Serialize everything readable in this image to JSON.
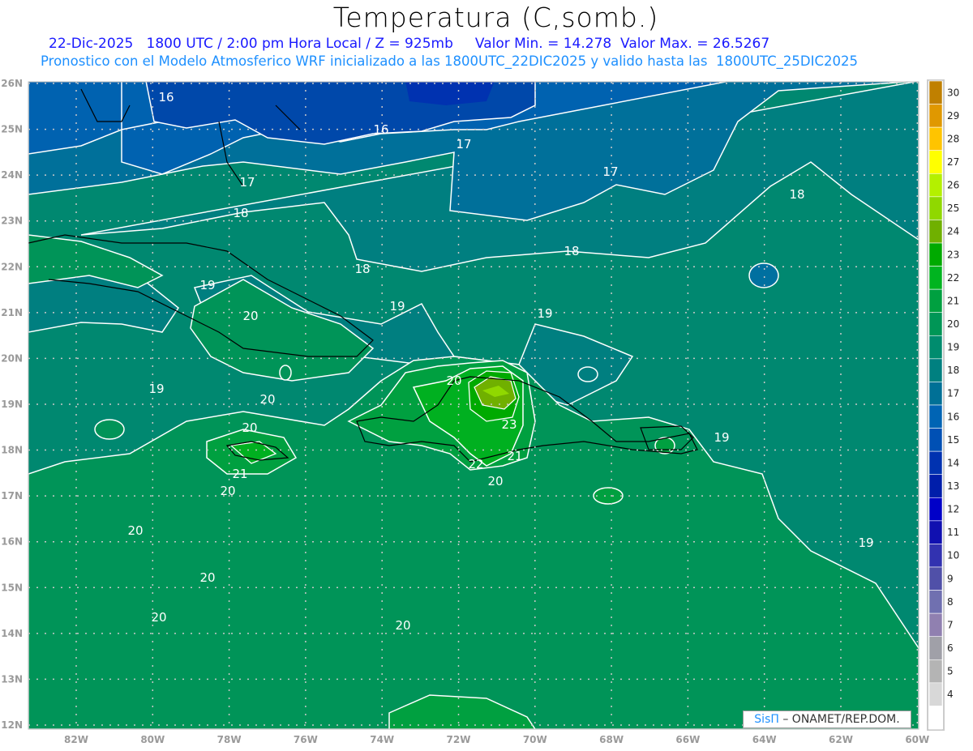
{
  "title": "Temperatura (C,somb.)",
  "subtitle_line1": "22-Dic-2025   1800 UTC / 2:00 pm Hora Local / Z = 925mb     Valor Min. = 14.278  Valor Max. = 26.5267",
  "subtitle_line2": "Pronostico con el Modelo Atmosferico WRF inicializado a las 1800UTC_22DIC2025 y valido hasta las  1800UTC_25DIC2025",
  "axes": {
    "lat_labels": [
      "26N",
      "25N",
      "24N",
      "23N",
      "22N",
      "21N",
      "20N",
      "19N",
      "18N",
      "17N",
      "16N",
      "15N",
      "14N",
      "13N",
      "12N"
    ],
    "lon_labels": [
      "82W",
      "80W",
      "78W",
      "76W",
      "74W",
      "72W",
      "70W",
      "68W",
      "66W",
      "64W",
      "62W",
      "60W"
    ]
  },
  "colorbar": {
    "labels": [
      "30",
      "29",
      "28",
      "27",
      "26",
      "25",
      "24",
      "23",
      "22",
      "21",
      "20",
      "19",
      "18",
      "17",
      "16",
      "15",
      "14",
      "13",
      "12",
      "11",
      "10",
      "9",
      "8",
      "7",
      "6",
      "5",
      "4"
    ],
    "colors": [
      "#c08000",
      "#e09800",
      "#ffc400",
      "#ffff00",
      "#b4f000",
      "#90d800",
      "#70b000",
      "#00aa00",
      "#00b420",
      "#00a040",
      "#009656",
      "#008c6e",
      "#008080",
      "#007096",
      "#0064b4",
      "#0050b4",
      "#0032b0",
      "#001eaa",
      "#0000c8",
      "#1010b0",
      "#3232b0",
      "#5050a8",
      "#7070b0",
      "#9080b0",
      "#a0a0a8",
      "#b4b4b4",
      "#d8d8d8",
      "#ffffff"
    ]
  },
  "contour_labels": [
    "16",
    "16",
    "17",
    "17",
    "17",
    "18",
    "18",
    "18",
    "18",
    "19",
    "19",
    "19",
    "19",
    "19",
    "19",
    "20",
    "20",
    "20",
    "20",
    "20",
    "20",
    "20",
    "20",
    "20",
    "20",
    "21",
    "21",
    "22",
    "23"
  ],
  "credit": {
    "brand": "SisΠ",
    "text": " – ONAMET/REP.DOM."
  }
}
